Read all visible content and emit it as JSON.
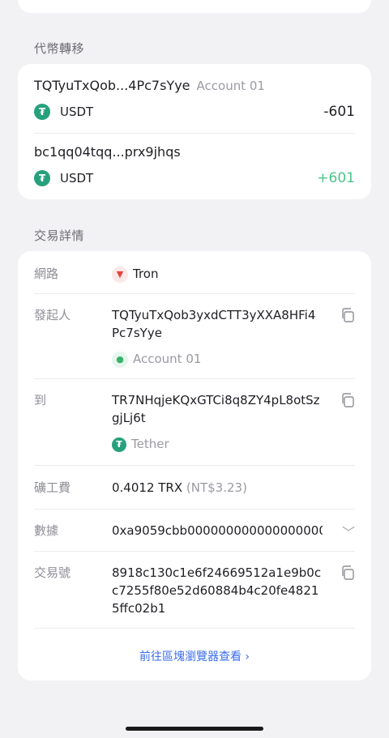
{
  "sections": {
    "token_transfer_title": "代幣轉移",
    "details_title": "交易詳情"
  },
  "transfer": {
    "from": {
      "address": "TQTyuTxQob...4Pc7sYye",
      "account": "Account 01",
      "token": "USDT",
      "amount": "-601"
    },
    "to": {
      "address": "bc1qq04tqq...prx9jhqs",
      "token": "USDT",
      "amount": "+601"
    }
  },
  "details": {
    "network_label": "網路",
    "network_value": "Tron",
    "initiator_label": "發起人",
    "initiator_value": "TQTyuTxQob3yxdCTT3yXXA8HFi4Pc7sYye",
    "initiator_account": "Account 01",
    "to_label": "到",
    "to_value": "TR7NHqjeKQxGTCi8q8ZY4pL8otSzgjLj6t",
    "to_name": "Tether",
    "fee_label": "礦工費",
    "fee_value": "0.4012 TRX",
    "fee_fiat": "(NT$3.23)",
    "data_label": "數據",
    "data_value": "0xa9059cbb000000000000000000...",
    "txid_label": "交易號",
    "txid_value": "8918c130c1e6f24669512a1e9b0cc7255f80e52d60884b4c20fe48215ffc02b1",
    "explorer_link": "前往區塊瀏覽器查看 ›"
  },
  "colors": {
    "positive": "#4cc38a",
    "link": "#3a6df0",
    "tether": "#26a17b"
  }
}
